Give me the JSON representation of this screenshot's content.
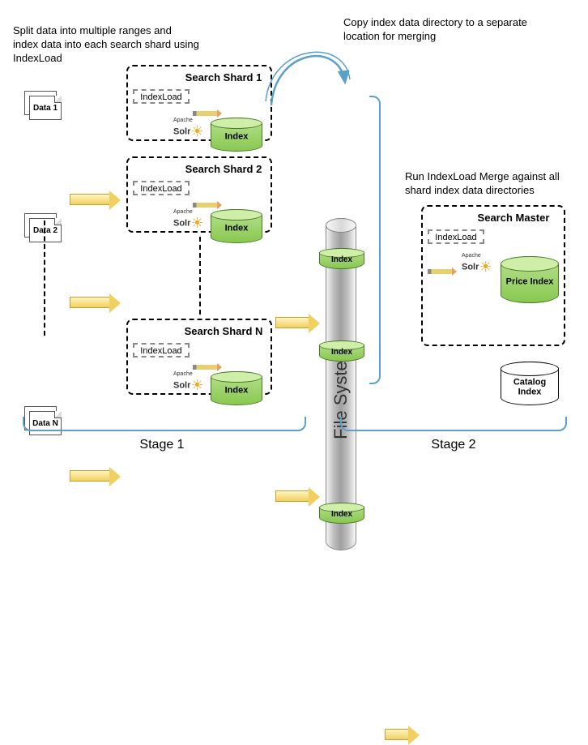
{
  "captions": {
    "split": "Split data into multiple ranges and index data into each search shard using IndexLoad",
    "copy": "Copy index data directory to a separate location for merging",
    "merge": "Run IndexLoad Merge against all shard index data directories"
  },
  "data_items": [
    "Data 1",
    "Data 2",
    "Data N"
  ],
  "shards": [
    "Search Shard 1",
    "Search Shard 2",
    "Search Shard N"
  ],
  "index_load": "IndexLoad",
  "index_label": "Index",
  "solr": {
    "apache": "Apache",
    "name": "Solr"
  },
  "file_system": "File System",
  "master": {
    "title": "Search Master",
    "price": "Price Index",
    "catalog": "Catalog Index"
  },
  "stages": {
    "s1": "Stage 1",
    "s2": "Stage 2"
  }
}
